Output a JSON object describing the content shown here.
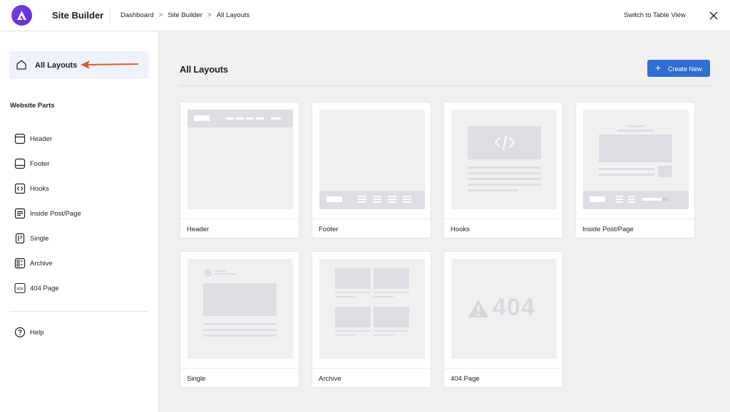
{
  "topbar": {
    "app_title": "Site Builder",
    "breadcrumb": [
      "Dashboard",
      "Site Builder",
      "All Layouts"
    ],
    "breadcrumb_separator": ">",
    "switch_view_label": "Switch to Table View",
    "brand_color": "#6b35e0"
  },
  "sidebar": {
    "all_layouts_label": "All Layouts",
    "section_heading": "Website Parts",
    "items": [
      {
        "label": "Header",
        "icon": "header-layout-icon"
      },
      {
        "label": "Footer",
        "icon": "footer-layout-icon"
      },
      {
        "label": "Hooks",
        "icon": "code-brackets-icon"
      },
      {
        "label": "Inside Post/Page",
        "icon": "post-lines-icon"
      },
      {
        "label": "Single",
        "icon": "single-page-icon"
      },
      {
        "label": "Archive",
        "icon": "archive-grid-icon"
      },
      {
        "label": "404 Page",
        "icon": "404-badge-icon",
        "icon_text": "404"
      }
    ],
    "help_label": "Help",
    "annotation_color": "#e05a2b"
  },
  "main": {
    "title": "All Layouts",
    "create_button_label": "Create New",
    "create_button_color": "#2f6ed3",
    "cards": [
      {
        "label": "Header"
      },
      {
        "label": "Footer"
      },
      {
        "label": "Hooks"
      },
      {
        "label": "Inside Post/Page"
      },
      {
        "label": "Single"
      },
      {
        "label": "Archive"
      },
      {
        "label": "404 Page",
        "preview_text": "404"
      }
    ]
  }
}
